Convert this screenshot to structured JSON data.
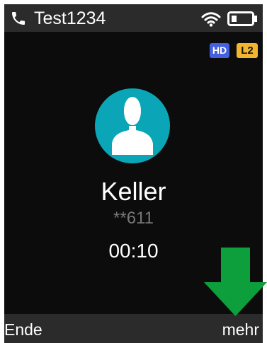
{
  "status_bar": {
    "title": "Test1234",
    "phone_icon": "phone-handset-icon",
    "wifi_icon": "wifi-icon",
    "battery_icon": "battery-icon"
  },
  "badges": {
    "hd": "HD",
    "line": "L2"
  },
  "call": {
    "avatar_icon": "user-silhouette-icon",
    "caller_name": "Keller",
    "caller_number": "**611",
    "duration": "00:10"
  },
  "softkeys": {
    "left": "Ende",
    "right": "mehr"
  },
  "annotation": {
    "arrow_icon": "down-arrow-icon",
    "arrow_color": "#0c9f3b"
  },
  "colors": {
    "screen_background": "#0c0c0c",
    "bar_background": "#2b2b2b",
    "avatar_teal": "#0aa6b7",
    "hd_badge": "#4561dd",
    "line_badge": "#f1b62f",
    "secondary_text": "#777777"
  }
}
